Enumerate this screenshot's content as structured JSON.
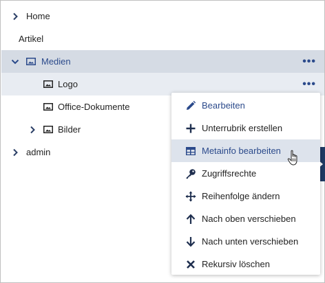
{
  "tree": {
    "items": [
      {
        "label": "Home"
      },
      {
        "label": "Artikel"
      },
      {
        "label": "Medien"
      },
      {
        "label": "Logo"
      },
      {
        "label": "Office-Dokumente"
      },
      {
        "label": "Bilder"
      },
      {
        "label": "admin"
      }
    ],
    "more_label": "•••"
  },
  "context_menu": {
    "items": [
      {
        "label": "Bearbeiten",
        "icon": "pencil-icon"
      },
      {
        "label": "Unterrubrik erstellen",
        "icon": "plus-icon"
      },
      {
        "label": "Metainfo bearbeiten",
        "icon": "table-icon"
      },
      {
        "label": "Zugriffsrechte",
        "icon": "key-icon"
      },
      {
        "label": "Reihenfolge ändern",
        "icon": "move-icon"
      },
      {
        "label": "Nach oben verschieben",
        "icon": "arrow-up-icon"
      },
      {
        "label": "Nach unten verschieben",
        "icon": "arrow-down-icon"
      },
      {
        "label": "Rekursiv löschen",
        "icon": "close-icon"
      }
    ]
  },
  "colors": {
    "accent": "#2b4a8b",
    "selected_row": "#d5dbe4",
    "child_row": "#e8ecf2",
    "menu_hover": "#dde3ec",
    "side_tab": "#1f3a64"
  }
}
